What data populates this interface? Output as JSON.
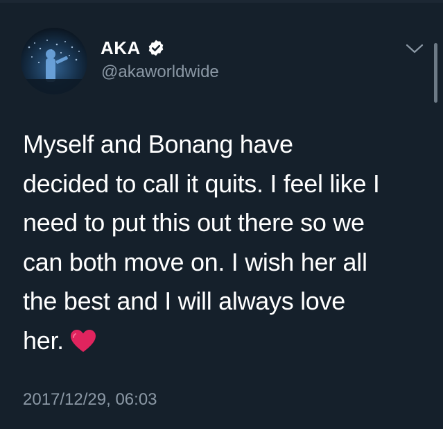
{
  "tweet": {
    "display_name": "AKA",
    "handle": "@akaworldwide",
    "verified": true,
    "lines": [
      "Myself and Bonang have",
      "decided to call it quits. I feel like I",
      "need to put this out there so we",
      "can both move on. I wish her all",
      "the best and I will always love",
      "her."
    ],
    "emoji": "red-heart",
    "timestamp": "2017/12/29, 06:03"
  },
  "icons": {
    "verified": "verified-badge-icon",
    "menu": "chevron-down-icon",
    "emoji": "red-heart-icon"
  },
  "colors": {
    "background": "#15202b",
    "secondary_text": "#8b98a5",
    "primary_text": "#ffffff",
    "heart": "#e0245e"
  }
}
